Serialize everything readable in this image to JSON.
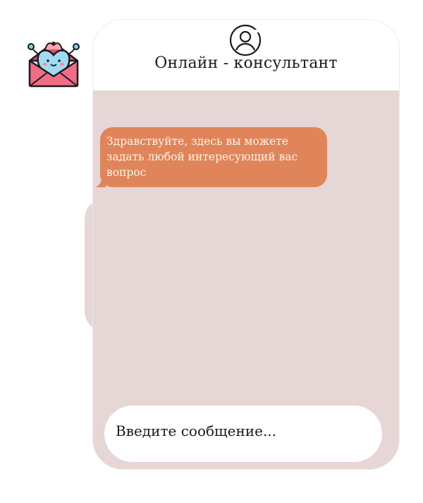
{
  "header": {
    "title": "Онлайн - консультант",
    "icon": "user-circle-icon"
  },
  "logo": {
    "icon": "envelope-heart-mascot-icon"
  },
  "messages": [
    {
      "from": "consultant",
      "text": "Здравствуйте, здесь вы можете задать любой интересующий вас вопрос"
    }
  ],
  "input": {
    "placeholder": "Введите сообщение..."
  },
  "colors": {
    "chat_bg": "#e6d6d5",
    "bubble": "#e0855a",
    "bubble_text": "#fbf2ec",
    "header_bg": "#ffffff"
  }
}
